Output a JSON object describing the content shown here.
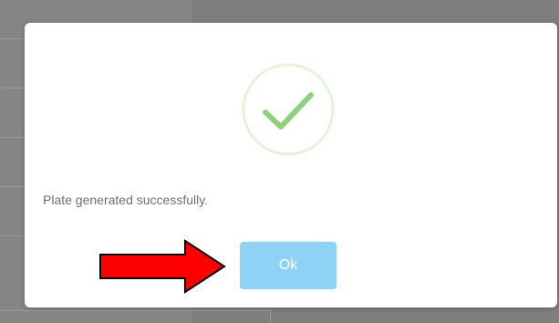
{
  "dialog": {
    "message": "Plate generated successfully.",
    "ok_label": "Ok"
  },
  "icons": {
    "success": "checkmark-circle-icon",
    "annotation": "red-arrow-right-icon"
  },
  "colors": {
    "overlay": "#7e7e7e",
    "modal_bg": "#ffffff",
    "check": "#8fd27b",
    "check_ring": "#e3f3dc",
    "ok_button": "#8ed3f5",
    "arrow": "#ff0000",
    "message_text": "#6f6f6f"
  }
}
